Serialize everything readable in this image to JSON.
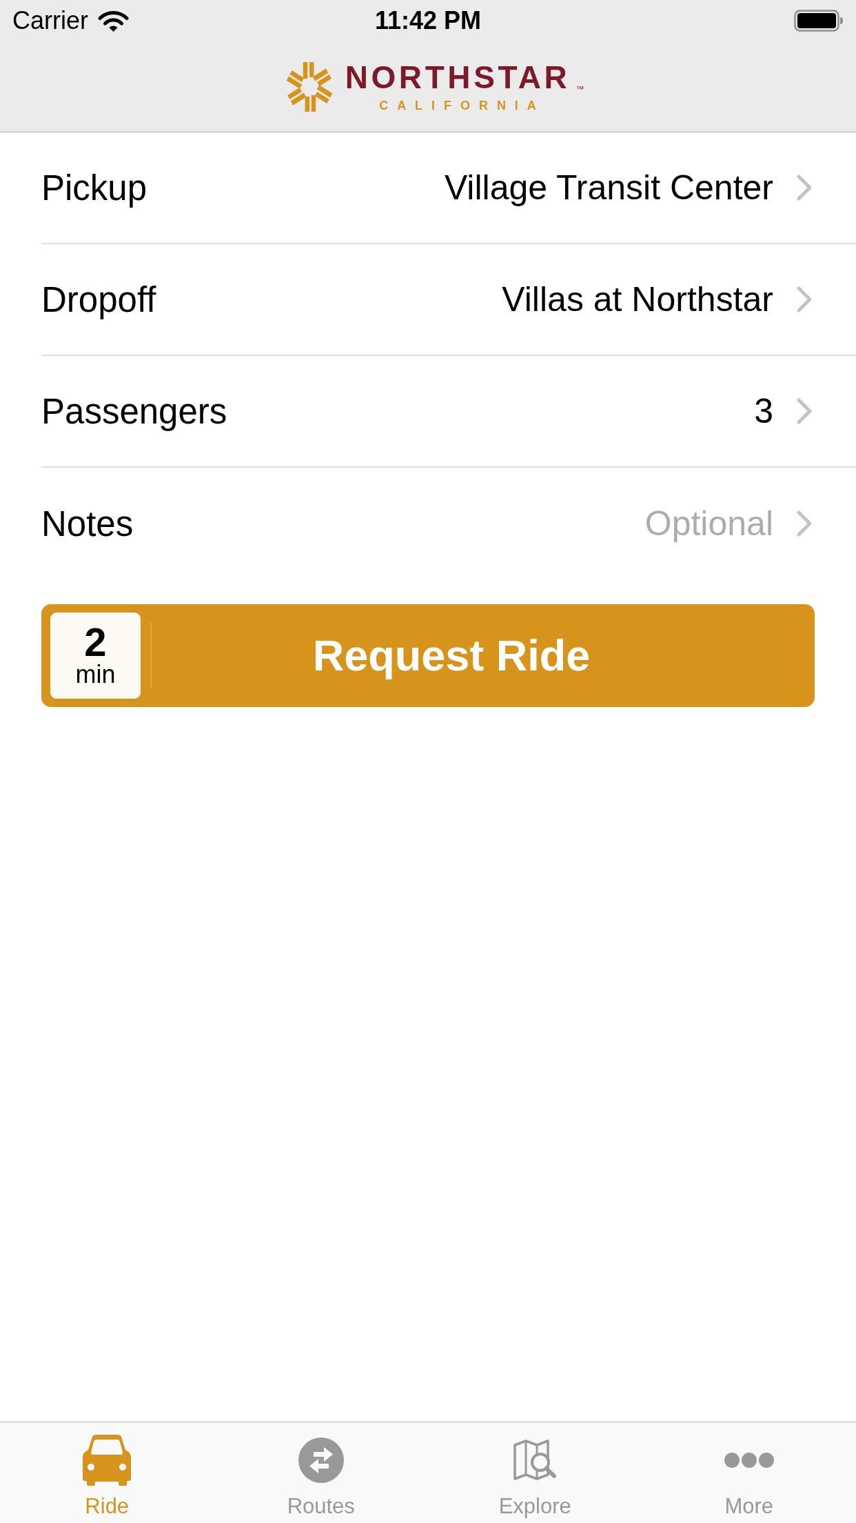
{
  "status_bar": {
    "carrier": "Carrier",
    "time": "11:42 PM"
  },
  "header": {
    "logo": {
      "name": "NORTHSTAR",
      "trademark": "™",
      "subtitle": "CALIFORNIA"
    }
  },
  "form_rows": [
    {
      "label": "Pickup",
      "value": "Village Transit Center"
    },
    {
      "label": "Dropoff",
      "value": "Villas at Northstar"
    },
    {
      "label": "Passengers",
      "value": "3"
    },
    {
      "label": "Notes",
      "placeholder": "Optional"
    }
  ],
  "request_button": {
    "wait_time": "2",
    "wait_unit": "min",
    "label": "Request Ride"
  },
  "tab_bar": {
    "tabs": [
      {
        "label": "Ride",
        "selected": true
      },
      {
        "label": "Routes",
        "selected": false
      },
      {
        "label": "Explore",
        "selected": false
      },
      {
        "label": "More",
        "selected": false
      }
    ]
  }
}
